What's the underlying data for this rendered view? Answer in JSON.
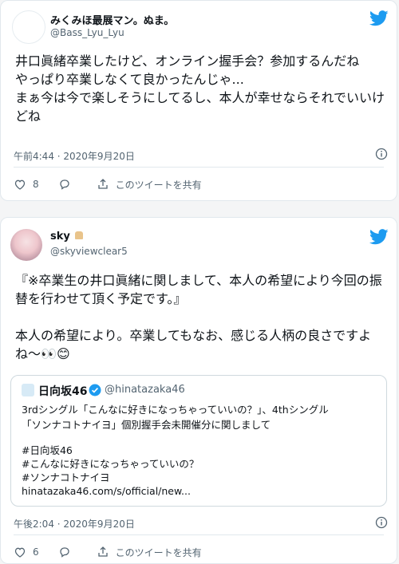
{
  "tweets": [
    {
      "user_name": "みくみほ最展マン。ぬま。",
      "user_handle": "@Bass_Lyu_Lyu",
      "text": "井口眞緒卒業したけど、オンライン握手会？参加するんだね\nやっぱり卒業しなくて良かったんじゃ...\nまぁ今は今で楽しそうにしてるし、本人が幸せならそれでいいけどね",
      "time": "午前4:44 · 2020年9月20日",
      "like_count": "8",
      "share_label": "このツイートを共有"
    },
    {
      "user_name": "sky",
      "user_handle": "@skyviewclear5",
      "text": "『※卒業生の井口眞緒に関しまして、本人の希望により今回の振替を行わせて頂く予定です。』\n\n本人の希望により。卒業してもなお、感じる人柄の良さですよね〜",
      "emoji": "👀😊",
      "quote": {
        "name": "日向坂46",
        "handle": "@hinatazaka46",
        "lines": [
          "3rdシングル「こんなに好きになっちゃっていいの？」、4thシングル",
          "「ソンナコトナイヨ」個別握手会未開催分に関しまして",
          "#日向坂46",
          "#こんなに好きになっちゃっていいの？",
          "#ソンナコトナイヨ",
          "hinatazaka46.com/s/official/new..."
        ]
      },
      "time": "午後2:04 · 2020年9月20日",
      "like_count": "6",
      "share_label": "このツイートを共有"
    }
  ],
  "colors": {
    "twitter_blue": "#1d9bf0"
  }
}
